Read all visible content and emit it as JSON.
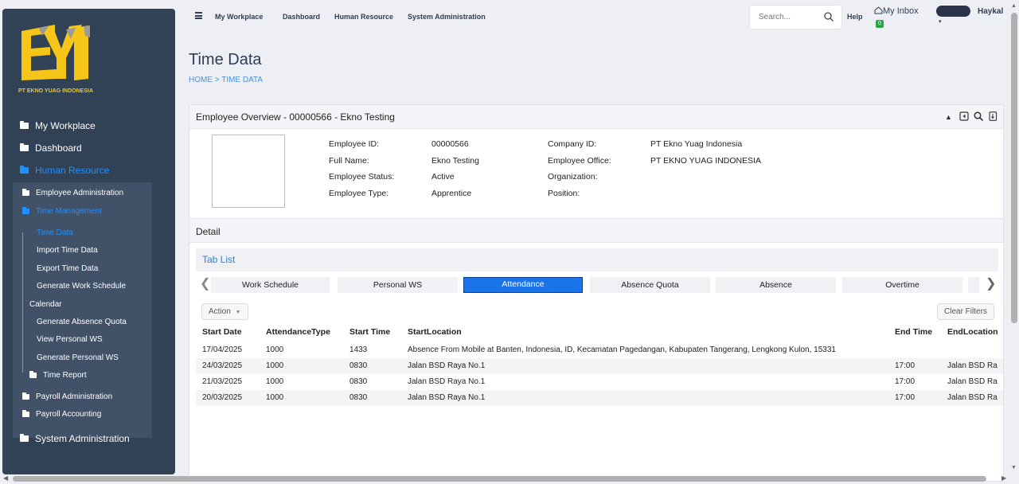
{
  "sidebar": {
    "logo_text": "PT EKNO YUAG INDONESIA",
    "items": [
      {
        "label": "My Workplace"
      },
      {
        "label": "Dashboard"
      },
      {
        "label": "Human Resource"
      },
      {
        "label": "System Administration"
      }
    ],
    "hr_items": [
      {
        "label": "Employee Administration"
      },
      {
        "label": "Time Management"
      },
      {
        "label": "Payroll Administration"
      },
      {
        "label": "Payroll Accounting"
      }
    ],
    "time_items": [
      {
        "label": "Time Data"
      },
      {
        "label": "Import Time Data"
      },
      {
        "label": "Export Time Data"
      },
      {
        "label": "Generate Work Schedule"
      },
      {
        "label": "Calendar"
      },
      {
        "label": "Generate Absence Quota"
      },
      {
        "label": "View Personal WS"
      },
      {
        "label": "Generate Personal WS"
      },
      {
        "label": "Time Report"
      }
    ]
  },
  "header": {
    "nav": [
      "My Workplace",
      "Dashboard",
      "Human Resource",
      "System Administration"
    ],
    "search_placeholder": "Search...",
    "help": "Help",
    "inbox_label": "My Inbox",
    "inbox_count": "0",
    "user_name": "Haykal"
  },
  "page": {
    "title": "Time Data",
    "breadcrumb": "HOME > TIME DATA"
  },
  "overview": {
    "title": "Employee Overview - 00000566 - Ekno Testing",
    "fields_left": [
      {
        "label": "Employee ID:",
        "value": "00000566"
      },
      {
        "label": "Full Name:",
        "value": "Ekno Testing"
      },
      {
        "label": "Employee Status:",
        "value": "Active"
      },
      {
        "label": "Employee Type:",
        "value": "Apprentice"
      }
    ],
    "fields_right": [
      {
        "label": "Company ID:",
        "value": "PT Ekno Yuag Indonesia"
      },
      {
        "label": "Employee Office:",
        "value": "PT EKNO YUAG INDONESIA"
      },
      {
        "label": "Organization:",
        "value": ""
      },
      {
        "label": "Position:",
        "value": ""
      }
    ]
  },
  "detail": {
    "title": "Detail",
    "tab_list_label": "Tab List",
    "tabs": [
      "Work Schedule",
      "Personal WS",
      "Attendance",
      "Absence Quota",
      "Absence",
      "Overtime"
    ],
    "active_tab": "Attendance",
    "action_label": "Action",
    "clear_filters_label": "Clear Filters",
    "columns": [
      "Start Date",
      "AttendanceType",
      "Start Time",
      "StartLocation",
      "End Time",
      "EndLocation"
    ],
    "rows": [
      [
        "17/04/2025",
        "1000",
        "1433",
        "Absence From Mobile at Banten, Indonesia, ID, Kecamatan Pagedangan, Kabupaten Tangerang, Lengkong Kulon, 15331",
        "",
        ""
      ],
      [
        "24/03/2025",
        "1000",
        "0830",
        "Jalan BSD Raya No.1",
        "17:00",
        "Jalan BSD Ra"
      ],
      [
        "21/03/2025",
        "1000",
        "0830",
        "Jalan BSD Raya No.1",
        "17:00",
        "Jalan BSD Ra"
      ],
      [
        "20/03/2025",
        "1000",
        "0830",
        "Jalan BSD Raya No.1",
        "17:00",
        "Jalan BSD Ra"
      ]
    ]
  },
  "colors": {
    "sidebar": "#324256",
    "active": "#1e90ff",
    "logo": "#f5c518",
    "tab_active": "#1a73e8"
  }
}
